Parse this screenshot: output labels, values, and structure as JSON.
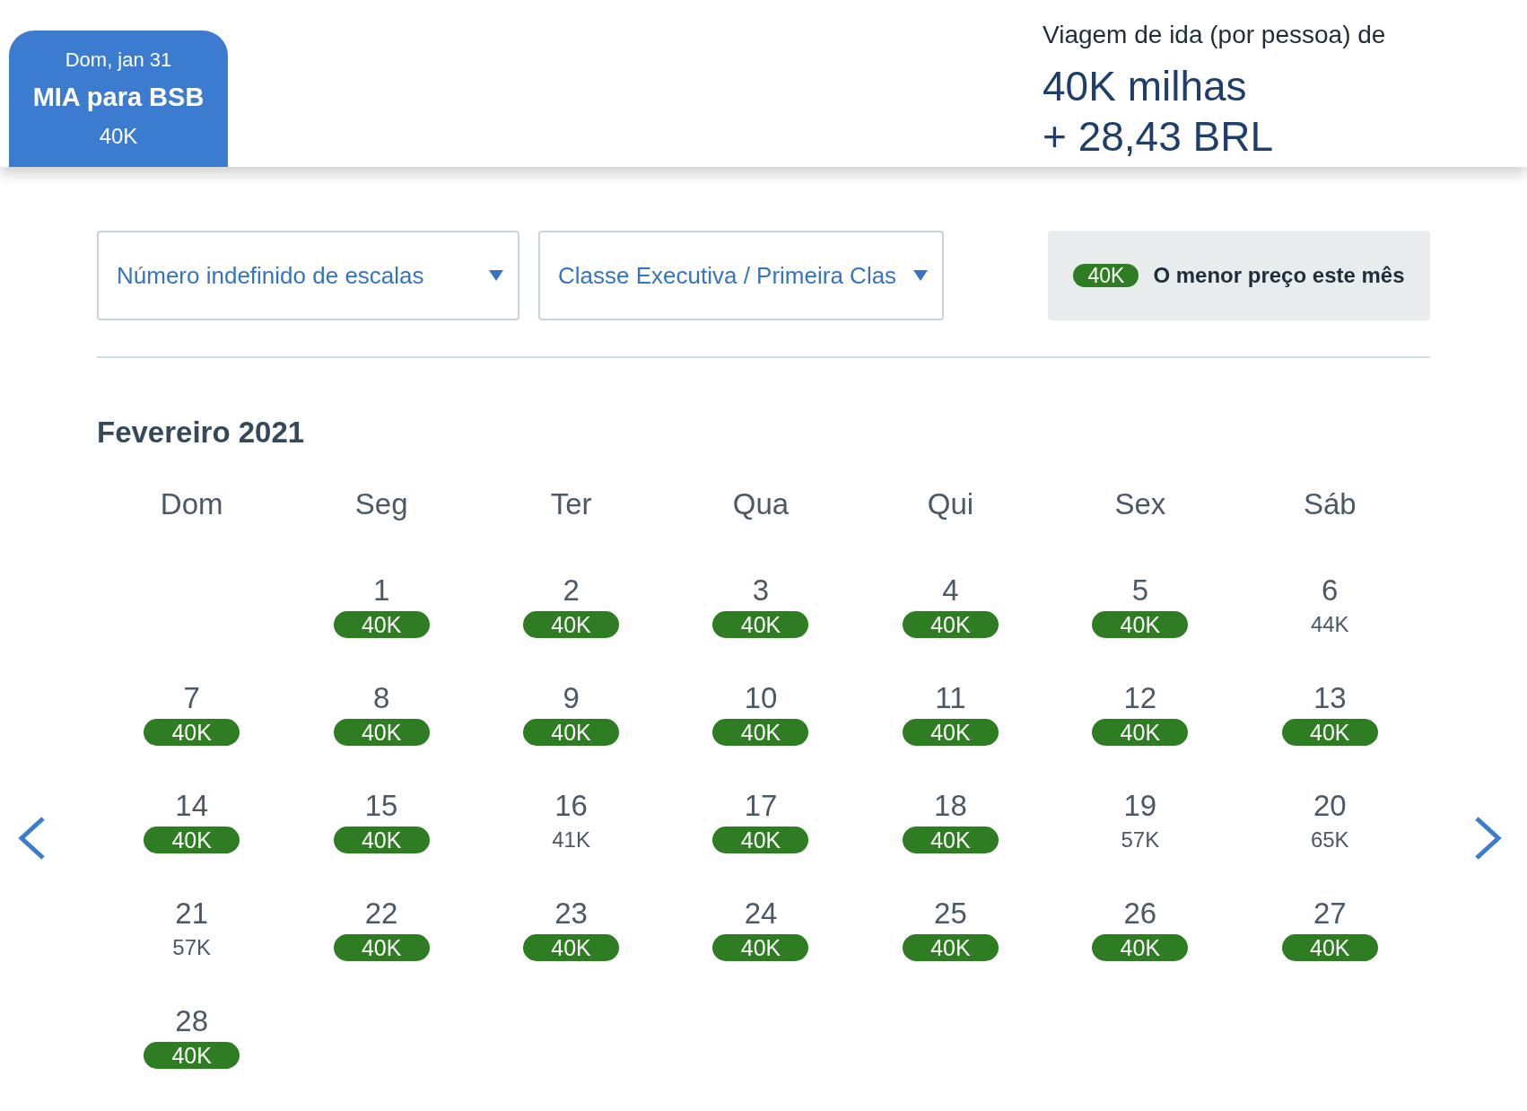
{
  "trip_tab": {
    "date": "Dom, jan 31",
    "route": "MIA para BSB",
    "price": "40K"
  },
  "fare": {
    "label": "Viagem de ida (por pessoa) de",
    "miles": "40K milhas",
    "taxes": "+ 28,43 BRL"
  },
  "filters": [
    {
      "label": "Número indefinido de escalas"
    },
    {
      "label": "Classe Executiva / Primeira Clas"
    }
  ],
  "legend": {
    "badge": "40K",
    "text": "O menor preço este mês"
  },
  "month": "Fevereiro 2021",
  "weekdays": [
    "Dom",
    "Seg",
    "Ter",
    "Qua",
    "Qui",
    "Sex",
    "Sáb"
  ],
  "weeks": [
    [
      {
        "day": "1",
        "price": "40K",
        "lowest": true
      },
      {
        "day": "2",
        "price": "40K",
        "lowest": true
      },
      {
        "day": "3",
        "price": "40K",
        "lowest": true
      },
      {
        "day": "4",
        "price": "40K",
        "lowest": true
      },
      {
        "day": "5",
        "price": "40K",
        "lowest": true
      },
      {
        "day": "6",
        "price": "44K",
        "lowest": false
      }
    ],
    [
      {
        "day": "7",
        "price": "40K",
        "lowest": true
      },
      {
        "day": "8",
        "price": "40K",
        "lowest": true
      },
      {
        "day": "9",
        "price": "40K",
        "lowest": true
      },
      {
        "day": "10",
        "price": "40K",
        "lowest": true
      },
      {
        "day": "11",
        "price": "40K",
        "lowest": true
      },
      {
        "day": "12",
        "price": "40K",
        "lowest": true
      },
      {
        "day": "13",
        "price": "40K",
        "lowest": true
      }
    ],
    [
      {
        "day": "14",
        "price": "40K",
        "lowest": true
      },
      {
        "day": "15",
        "price": "40K",
        "lowest": true
      },
      {
        "day": "16",
        "price": "41K",
        "lowest": false
      },
      {
        "day": "17",
        "price": "40K",
        "lowest": true
      },
      {
        "day": "18",
        "price": "40K",
        "lowest": true
      },
      {
        "day": "19",
        "price": "57K",
        "lowest": false
      },
      {
        "day": "20",
        "price": "65K",
        "lowest": false
      }
    ],
    [
      {
        "day": "21",
        "price": "57K",
        "lowest": false
      },
      {
        "day": "22",
        "price": "40K",
        "lowest": true
      },
      {
        "day": "23",
        "price": "40K",
        "lowest": true
      },
      {
        "day": "24",
        "price": "40K",
        "lowest": true
      },
      {
        "day": "25",
        "price": "40K",
        "lowest": true
      },
      {
        "day": "26",
        "price": "40K",
        "lowest": true
      },
      {
        "day": "27",
        "price": "40K",
        "lowest": true
      }
    ],
    [
      {
        "day": "28",
        "price": "40K",
        "lowest": true
      }
    ]
  ]
}
